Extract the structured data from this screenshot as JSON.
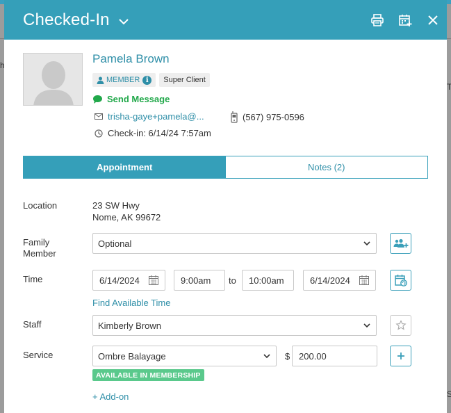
{
  "modal": {
    "title": "Checked-In"
  },
  "client": {
    "name": "Pamela Brown",
    "member_label": "MEMBER",
    "member_info": "i",
    "tag": "Super Client",
    "send_message": "Send Message",
    "email": "trisha-gaye+pamela@...",
    "phone": "(567) 975-0596",
    "checkin": "Check-in: 6/14/24 7:57am"
  },
  "tabs": [
    {
      "label": "Appointment",
      "active": true
    },
    {
      "label": "Notes (2)",
      "active": false
    }
  ],
  "form": {
    "location_label": "Location",
    "location_line1": "23 SW Hwy",
    "location_line2": "Nome, AK 99672",
    "family_label_1": "Family",
    "family_label_2": "Member",
    "family_value": "Optional",
    "time_label": "Time",
    "start_date": "6/14/2024",
    "start_time": "9:00am",
    "to_label": "to",
    "end_time": "10:00am",
    "end_date": "6/14/2024",
    "find_time": "Find Available Time",
    "staff_label": "Staff",
    "staff_value": "Kimberly Brown",
    "service_label": "Service",
    "service_value": "Ombre Balayage",
    "currency": "$",
    "price": "200.00",
    "membership_badge": "AVAILABLE IN MEMBERSHIP",
    "add_on": "+ Add-on"
  },
  "background": {
    "frag_1": "h",
    "frag_2": "T",
    "frag_3": "S"
  },
  "colors": {
    "header": "#359fb9",
    "accent": "#2f8fa8",
    "success": "#21a84a",
    "membership": "#5ac98c"
  },
  "icons": {
    "title_dropdown": "chevron-down-icon",
    "print": "printer-icon",
    "calendar_add": "calendar-plus-icon",
    "close": "close-icon",
    "member": "person-icon",
    "chat": "chat-bubble-icon",
    "email": "envelope-icon",
    "phone": "mobile-phone-icon",
    "clock": "clock-icon",
    "family": "group-add-icon",
    "recurring": "calendar-repeat-icon",
    "favorite": "star-icon",
    "add": "plus-icon"
  }
}
